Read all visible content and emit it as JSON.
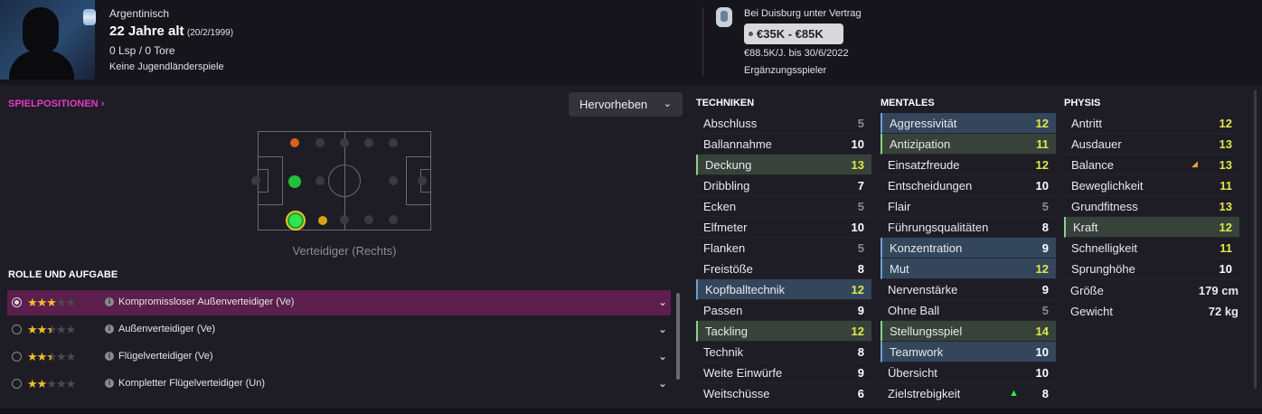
{
  "player": {
    "nationality": "Argentinisch",
    "age": "22 Jahre alt",
    "birthdate": "(20/2/1999)",
    "caps": "0 Lsp / 0 Tore",
    "youth": "Keine Jugendländerspiele"
  },
  "contract": {
    "status": "Bei Duisburg unter Vertrag",
    "value": "€35K - €85K",
    "wage": "€88.5K/J. bis 30/6/2022",
    "squad_status": "Ergänzungsspieler"
  },
  "positions": {
    "title": "SPIELPOSITIONEN",
    "highlight_btn": "Hervorheben",
    "selected_position": "Verteidiger (Rechts)"
  },
  "roles": {
    "title": "ROLLE UND AUFGABE",
    "items": [
      {
        "name": "Kompromissloser Außenverteidiger (Ve)",
        "stars": 3
      },
      {
        "name": "Außenverteidiger (Ve)",
        "stars": 2.5
      },
      {
        "name": "Flügelverteidiger (Ve)",
        "stars": 2.5
      },
      {
        "name": "Kompletter Flügelverteidiger (Un)",
        "stars": 2
      }
    ]
  },
  "techniken": {
    "title": "TECHNIKEN",
    "items": [
      {
        "name": "Abschluss",
        "value": "5"
      },
      {
        "name": "Ballannahme",
        "value": "10"
      },
      {
        "name": "Deckung",
        "value": "13"
      },
      {
        "name": "Dribbling",
        "value": "7"
      },
      {
        "name": "Ecken",
        "value": "5"
      },
      {
        "name": "Elfmeter",
        "value": "10"
      },
      {
        "name": "Flanken",
        "value": "5"
      },
      {
        "name": "Freistöße",
        "value": "8"
      },
      {
        "name": "Kopfballtechnik",
        "value": "12"
      },
      {
        "name": "Passen",
        "value": "9"
      },
      {
        "name": "Tackling",
        "value": "12"
      },
      {
        "name": "Technik",
        "value": "8"
      },
      {
        "name": "Weite Einwürfe",
        "value": "9"
      },
      {
        "name": "Weitschüsse",
        "value": "6"
      }
    ]
  },
  "mentales": {
    "title": "MENTALES",
    "items": [
      {
        "name": "Aggressivität",
        "value": "12"
      },
      {
        "name": "Antizipation",
        "value": "11"
      },
      {
        "name": "Einsatzfreude",
        "value": "12"
      },
      {
        "name": "Entscheidungen",
        "value": "10"
      },
      {
        "name": "Flair",
        "value": "5"
      },
      {
        "name": "Führungsqualitäten",
        "value": "8"
      },
      {
        "name": "Konzentration",
        "value": "9"
      },
      {
        "name": "Mut",
        "value": "12"
      },
      {
        "name": "Nervenstärke",
        "value": "9"
      },
      {
        "name": "Ohne Ball",
        "value": "5"
      },
      {
        "name": "Stellungsspiel",
        "value": "14"
      },
      {
        "name": "Teamwork",
        "value": "10"
      },
      {
        "name": "Übersicht",
        "value": "10"
      },
      {
        "name": "Zielstrebigkeit",
        "value": "8"
      }
    ]
  },
  "physis": {
    "title": "PHYSIS",
    "items": [
      {
        "name": "Antritt",
        "value": "12"
      },
      {
        "name": "Ausdauer",
        "value": "13"
      },
      {
        "name": "Balance",
        "value": "13"
      },
      {
        "name": "Beweglichkeit",
        "value": "11"
      },
      {
        "name": "Grundfitness",
        "value": "13"
      },
      {
        "name": "Kraft",
        "value": "12"
      },
      {
        "name": "Schnelligkeit",
        "value": "11"
      },
      {
        "name": "Sprunghöhe",
        "value": "10"
      }
    ],
    "height_label": "Größe",
    "height": "179 cm",
    "weight_label": "Gewicht",
    "weight": "72 kg"
  },
  "colors": {
    "accent": "#e23cc4",
    "highlight_blue": "#33465c",
    "highlight_green": "#37433a",
    "star": "#f3c026",
    "value_yellow": "#e0e84a"
  }
}
